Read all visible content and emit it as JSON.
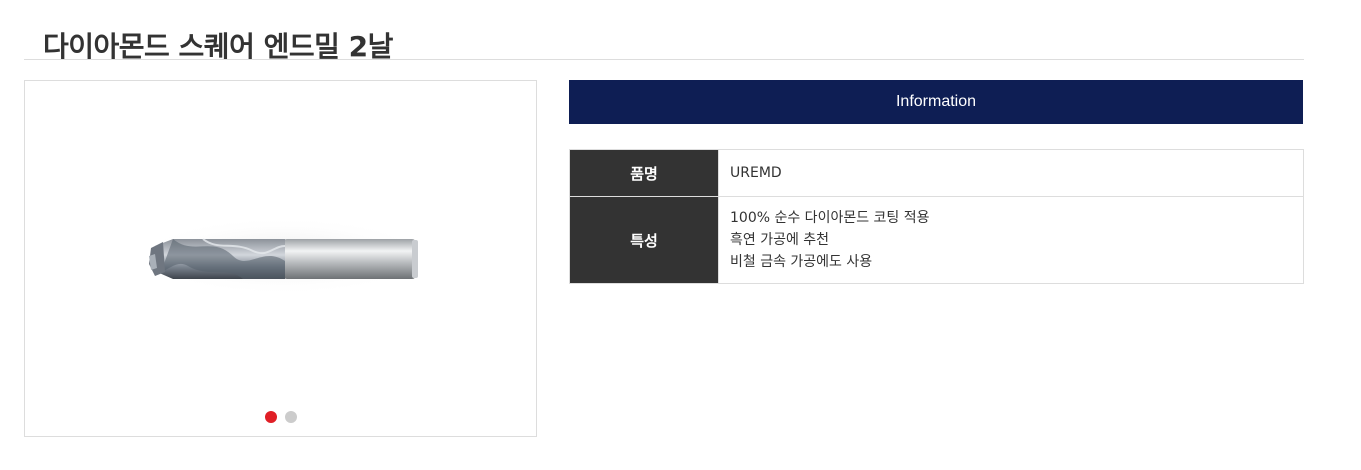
{
  "page": {
    "title": "다이아몬드 스퀘어 엔드밀 2날"
  },
  "gallery": {
    "image_icon": "end-mill-product-image",
    "dots": [
      {
        "active": true
      },
      {
        "active": false
      }
    ]
  },
  "info": {
    "header": "Information",
    "rows": [
      {
        "label": "품명",
        "value": "UREMD"
      },
      {
        "label": "특성",
        "lines": [
          "100% 순수 다이아몬드 코팅 적용",
          "흑연 가공에 추천",
          "비철 금속 가공에도 사용"
        ]
      }
    ]
  },
  "colors": {
    "header_bg": "#0e1e54",
    "label_bg": "#333333",
    "active_dot": "#e01f26",
    "inactive_dot": "#cccccc"
  }
}
